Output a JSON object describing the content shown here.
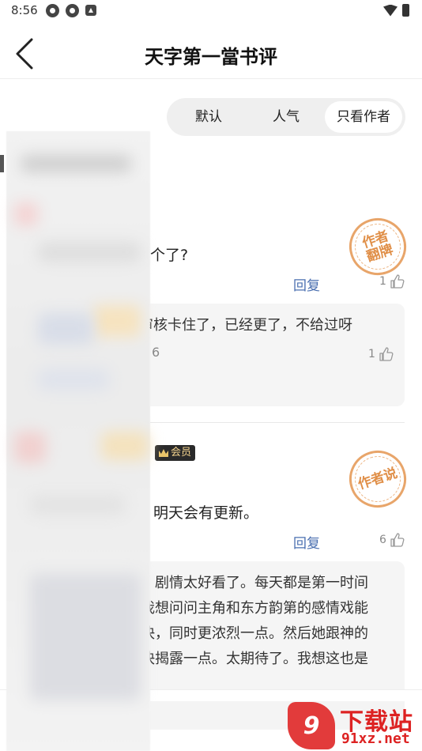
{
  "status_bar": {
    "time": "8:56"
  },
  "header": {
    "title": "天字第一當书评"
  },
  "filters": {
    "tabs": [
      "默认",
      "人气",
      "只看作者"
    ],
    "active_index": 2
  },
  "comments": [
    {
      "text": "个了?",
      "stamp": "作者\n翻牌",
      "reply_label": "回复",
      "likes": "1",
      "replies": [
        {
          "lines": [
            "审核卡住了，已经更了，不给过呀"
          ],
          "meta": "6",
          "likes": "1"
        }
      ]
    },
    {
      "badge": "会员",
      "text": "明天会有更新。",
      "stamp": "作者说",
      "reply_label": "回复",
      "likes": "6",
      "replies": [
        {
          "lines": [
            "剧情太好看了。每天都是第一时间",
            "我想问问主角和东方韵第的感情戏能",
            "快，同时更浓烈一点。然后她跟神的",
            "快揭露一点。太期待了。我想这也是"
          ]
        }
      ]
    }
  ],
  "watermark": {
    "logo": "9",
    "title": "下载站",
    "url": "91xz.net"
  },
  "colors": {
    "accent_link": "#4a6fb0",
    "stamp": "#e08f48",
    "watermark": "#dd2222",
    "vip_gold": "#f6d58f"
  }
}
